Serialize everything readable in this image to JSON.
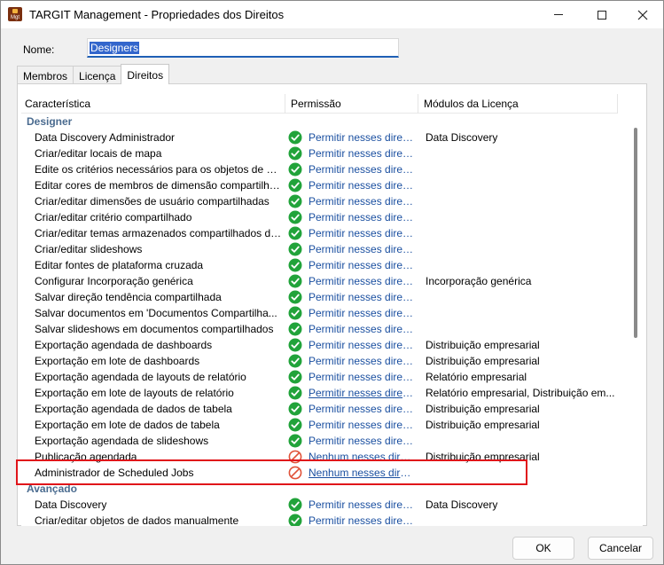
{
  "window": {
    "title": "TARGIT Management - Propriedades dos Direitos",
    "app_icon_text": "Mgt",
    "controls": [
      "minimize-icon",
      "maximize-icon",
      "close-icon"
    ]
  },
  "name_field": {
    "label": "Nome:",
    "value": "Designers"
  },
  "tabs": [
    {
      "label": "Membros",
      "active": false
    },
    {
      "label": "Licença",
      "active": false
    },
    {
      "label": "Direitos",
      "active": true
    }
  ],
  "columns": [
    "Característica",
    "Permissão",
    "Módulos da Licença"
  ],
  "groups": [
    {
      "name": "Designer",
      "rows": [
        {
          "feature": "Data Discovery Administrador",
          "permission": "Permitir nesses direit...",
          "status": "allow",
          "modules": "Data Discovery"
        },
        {
          "feature": "Criar/editar locais de mapa",
          "permission": "Permitir nesses direit...",
          "status": "allow",
          "modules": ""
        },
        {
          "feature": "Edite os critérios necessários para os objetos de da...",
          "permission": "Permitir nesses direit...",
          "status": "allow",
          "modules": ""
        },
        {
          "feature": "Editar cores de membros de dimensão compartilhad...",
          "permission": "Permitir nesses direit...",
          "status": "allow",
          "modules": ""
        },
        {
          "feature": "Criar/editar dimensões de usuário compartilhadas",
          "permission": "Permitir nesses direit...",
          "status": "allow",
          "modules": ""
        },
        {
          "feature": "Criar/editar critério compartilhado",
          "permission": "Permitir nesses direit...",
          "status": "allow",
          "modules": ""
        },
        {
          "feature": "Criar/editar temas armazenados compartilhados de...",
          "permission": "Permitir nesses direit...",
          "status": "allow",
          "modules": ""
        },
        {
          "feature": "Criar/editar slideshows",
          "permission": "Permitir nesses direit...",
          "status": "allow",
          "modules": ""
        },
        {
          "feature": "Editar fontes de plataforma cruzada",
          "permission": "Permitir nesses direit...",
          "status": "allow",
          "modules": ""
        },
        {
          "feature": "Configurar Incorporação genérica",
          "permission": "Permitir nesses direit...",
          "status": "allow",
          "modules": "Incorporação genérica"
        },
        {
          "feature": "Salvar direção tendência compartilhada",
          "permission": "Permitir nesses direit...",
          "status": "allow",
          "modules": ""
        },
        {
          "feature": "Salvar documentos em 'Documentos Compartilha...",
          "permission": "Permitir nesses direit...",
          "status": "allow",
          "modules": ""
        },
        {
          "feature": "Salvar slideshows em documentos compartilhados",
          "permission": "Permitir nesses direit...",
          "status": "allow",
          "modules": ""
        },
        {
          "feature": "Exportação agendada de dashboards",
          "permission": "Permitir nesses direit...",
          "status": "allow",
          "modules": "Distribuição empresarial"
        },
        {
          "feature": "Exportação em lote de dashboards",
          "permission": "Permitir nesses direit...",
          "status": "allow",
          "modules": "Distribuição empresarial"
        },
        {
          "feature": "Exportação agendada de layouts de relatório",
          "permission": "Permitir nesses direit...",
          "status": "allow",
          "modules": "Relatório empresarial"
        },
        {
          "feature": "Exportação em lote de layouts de relatório",
          "permission": "Permitir nesses direit...",
          "status": "allow",
          "modules": "Relatório empresarial, Distribuição em..."
        },
        {
          "feature": "Exportação agendada de dados de tabela",
          "permission": "Permitir nesses direit...",
          "status": "allow",
          "modules": "Distribuição empresarial"
        },
        {
          "feature": "Exportação em lote de dados de tabela",
          "permission": "Permitir nesses direit...",
          "status": "allow",
          "modules": "Distribuição empresarial"
        },
        {
          "feature": "Exportação agendada de slideshows",
          "permission": "Permitir nesses direit...",
          "status": "allow",
          "modules": ""
        },
        {
          "feature": "Publicação agendada",
          "permission": "Nenhum nesses direit...",
          "status": "deny",
          "modules": "Distribuição empresarial"
        },
        {
          "feature": "Administrador de Scheduled Jobs",
          "permission": "Nenhum nesses direi...",
          "status": "deny",
          "modules": ""
        }
      ]
    },
    {
      "name": "Avançado",
      "rows": [
        {
          "feature": "Data Discovery",
          "permission": "Permitir nesses direit...",
          "status": "allow",
          "modules": "Data Discovery"
        },
        {
          "feature": "Criar/editar objetos de dados manualmente",
          "permission": "Permitir nesses direit...",
          "status": "allow",
          "modules": ""
        }
      ]
    }
  ],
  "buttons": {
    "ok": "OK",
    "cancel": "Cancelar"
  },
  "colors": {
    "allow": "#21a33a",
    "deny": "#e0533a",
    "link": "#1a4fa0",
    "group_header": "#4a6b8f",
    "highlight": "#e0141a"
  }
}
